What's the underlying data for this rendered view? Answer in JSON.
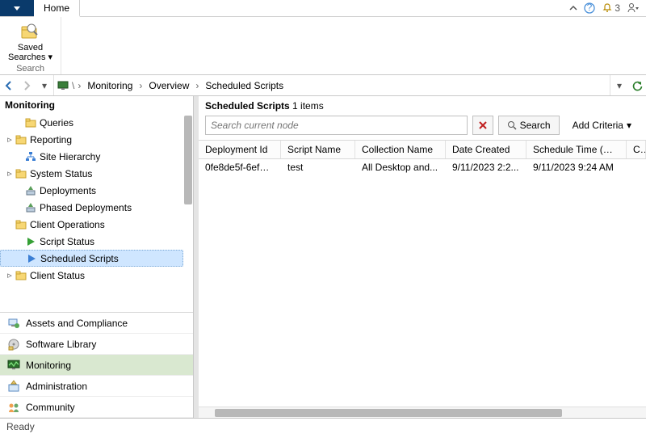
{
  "tabs": {
    "home": "Home"
  },
  "top_right": {
    "notif_count": "3"
  },
  "ribbon": {
    "saved_searches": "Saved\nSearches",
    "group_search": "Search"
  },
  "breadcrumb": {
    "items": [
      "Monitoring",
      "Overview",
      "Scheduled Scripts"
    ]
  },
  "left": {
    "title": "Monitoring",
    "tree": [
      {
        "label": "Queries",
        "exp": "",
        "icon": "folder",
        "indent": 1
      },
      {
        "label": "Reporting",
        "exp": "▹",
        "icon": "folder",
        "indent": 0
      },
      {
        "label": "Site Hierarchy",
        "exp": "",
        "icon": "hierarchy",
        "indent": 1
      },
      {
        "label": "System Status",
        "exp": "▹",
        "icon": "folder",
        "indent": 0
      },
      {
        "label": "Deployments",
        "exp": "",
        "icon": "deploy",
        "indent": 1
      },
      {
        "label": "Phased Deployments",
        "exp": "",
        "icon": "deploy",
        "indent": 1
      },
      {
        "label": "Client Operations",
        "exp": "",
        "icon": "folder",
        "indent": 0
      },
      {
        "label": "Script Status",
        "exp": "",
        "icon": "play-green",
        "indent": 1
      },
      {
        "label": "Scheduled Scripts",
        "exp": "",
        "icon": "play-blue",
        "indent": 1,
        "selected": true
      },
      {
        "label": "Client Status",
        "exp": "▹",
        "icon": "folder",
        "indent": 0
      }
    ],
    "sections": [
      {
        "label": "Assets and Compliance",
        "icon": "assets"
      },
      {
        "label": "Software Library",
        "icon": "library"
      },
      {
        "label": "Monitoring",
        "icon": "monitor",
        "active": true
      },
      {
        "label": "Administration",
        "icon": "admin"
      },
      {
        "label": "Community",
        "icon": "community"
      }
    ]
  },
  "content": {
    "title": "Scheduled Scripts",
    "count_label": "1 items",
    "search_placeholder": "Search current node",
    "search_btn": "Search",
    "add_criteria": "Add Criteria",
    "columns": [
      "Deployment Id",
      "Script Name",
      "Collection Name",
      "Date Created",
      "Schedule Time (UTC)",
      "Client Operation ID"
    ],
    "rows": [
      {
        "deployment_id": "0fe8de5f-6ef5-...",
        "script_name": "test",
        "collection_name": "All Desktop and...",
        "date_created": "9/11/2023 2:2...",
        "schedule_time": "9/11/2023 9:24 AM",
        "client_op_id": ""
      }
    ]
  },
  "status": "Ready"
}
